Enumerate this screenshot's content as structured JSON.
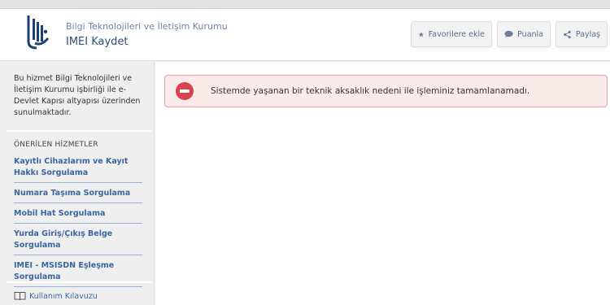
{
  "header": {
    "org_name": "Bilgi Teknolojileri ve İletişim Kurumu",
    "title": "IMEI Kaydet",
    "logo_icon": "btk-logo-icon",
    "buttons": {
      "favorite": {
        "label": "Favorilere ekle",
        "icon": "star-icon"
      },
      "rate": {
        "label": "Puanla",
        "icon": "speech-bubble-icon"
      },
      "share": {
        "label": "Paylaş",
        "icon": "share-icon"
      }
    }
  },
  "sidebar": {
    "info": "Bu hizmet Bilgi Teknolojileri ve İletişim Kurumu işbirliği ile e-Devlet Kapısı altyapısı üzerinden sunulmaktadır.",
    "heading": "ÖNERİLEN HİZMETLER",
    "links": [
      "Kayıtlı Cihazlarım ve Kayıt Hakkı Sorgulama",
      "Numara Taşıma Sorgulama",
      "Mobil Hat Sorgulama",
      "Yurda Giriş/Çıkış Belge Sorgulama",
      "IMEI - MSISDN Eşleşme Sorgulama"
    ],
    "manual": {
      "label": "Kullanım Kılavuzu",
      "icon": "book-icon"
    }
  },
  "alert": {
    "icon": "error-minus-icon",
    "message": "Sistemde yaşanan bir teknik aksaklık nedeni ile işleminiz tamamlanamadı."
  },
  "colors": {
    "link": "#3a66a0",
    "title": "#2c4d7a",
    "alert_background": "#fbeaea",
    "alert_border": "#e0a5a8",
    "alert_icon": "#d9434b"
  }
}
